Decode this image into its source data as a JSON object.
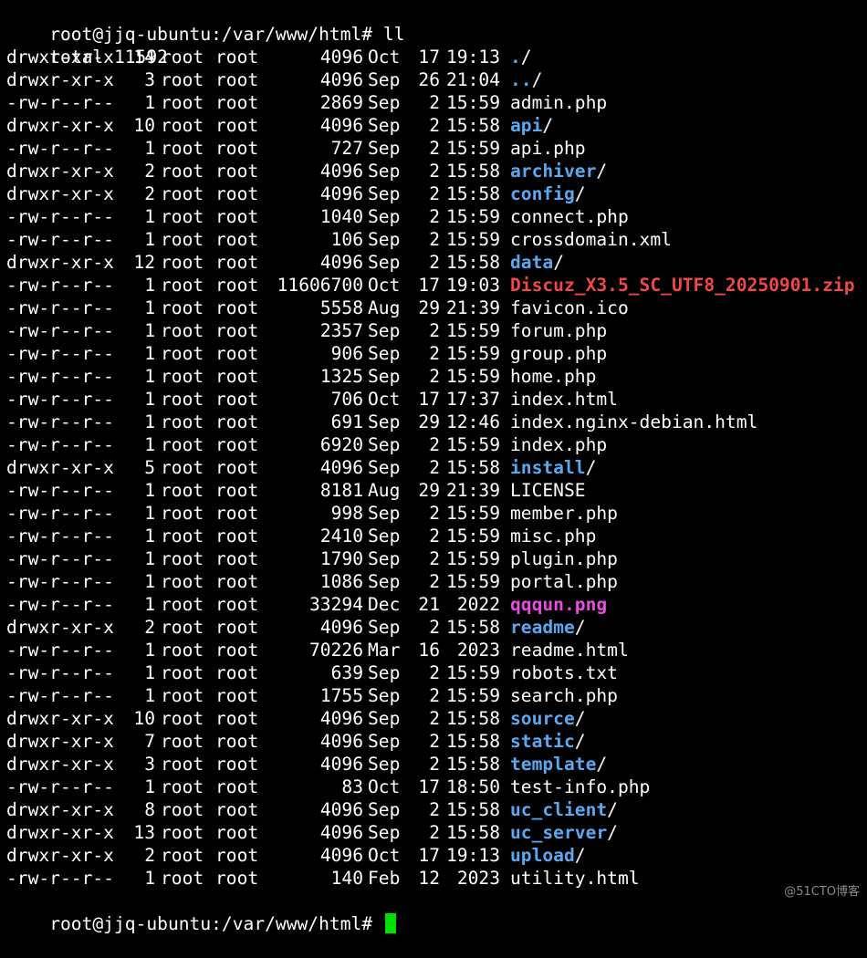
{
  "prompt_cmd": "root@jjq-ubuntu:/var/www/html# ll",
  "total": "total 11592",
  "entries": [
    {
      "perm": "drwxr-xr-x",
      "links": "14",
      "owner": "root",
      "group": "root",
      "size": "4096",
      "month": "Oct",
      "day": "17",
      "time": "19:13",
      "name": "./",
      "kind": "dir"
    },
    {
      "perm": "drwxr-xr-x",
      "links": "3",
      "owner": "root",
      "group": "root",
      "size": "4096",
      "month": "Sep",
      "day": "26",
      "time": "21:04",
      "name": "../",
      "kind": "dir"
    },
    {
      "perm": "-rw-r--r--",
      "links": "1",
      "owner": "root",
      "group": "root",
      "size": "2869",
      "month": "Sep",
      "day": "2",
      "time": "15:59",
      "name": "admin.php",
      "kind": "file"
    },
    {
      "perm": "drwxr-xr-x",
      "links": "10",
      "owner": "root",
      "group": "root",
      "size": "4096",
      "month": "Sep",
      "day": "2",
      "time": "15:58",
      "name": "api",
      "kind": "dir"
    },
    {
      "perm": "-rw-r--r--",
      "links": "1",
      "owner": "root",
      "group": "root",
      "size": "727",
      "month": "Sep",
      "day": "2",
      "time": "15:59",
      "name": "api.php",
      "kind": "file"
    },
    {
      "perm": "drwxr-xr-x",
      "links": "2",
      "owner": "root",
      "group": "root",
      "size": "4096",
      "month": "Sep",
      "day": "2",
      "time": "15:58",
      "name": "archiver",
      "kind": "dir"
    },
    {
      "perm": "drwxr-xr-x",
      "links": "2",
      "owner": "root",
      "group": "root",
      "size": "4096",
      "month": "Sep",
      "day": "2",
      "time": "15:58",
      "name": "config",
      "kind": "dir"
    },
    {
      "perm": "-rw-r--r--",
      "links": "1",
      "owner": "root",
      "group": "root",
      "size": "1040",
      "month": "Sep",
      "day": "2",
      "time": "15:59",
      "name": "connect.php",
      "kind": "file"
    },
    {
      "perm": "-rw-r--r--",
      "links": "1",
      "owner": "root",
      "group": "root",
      "size": "106",
      "month": "Sep",
      "day": "2",
      "time": "15:59",
      "name": "crossdomain.xml",
      "kind": "file"
    },
    {
      "perm": "drwxr-xr-x",
      "links": "12",
      "owner": "root",
      "group": "root",
      "size": "4096",
      "month": "Sep",
      "day": "2",
      "time": "15:58",
      "name": "data",
      "kind": "dir"
    },
    {
      "perm": "-rw-r--r--",
      "links": "1",
      "owner": "root",
      "group": "root",
      "size": "11606700",
      "month": "Oct",
      "day": "17",
      "time": "19:03",
      "name": "Discuz_X3.5_SC_UTF8_20250901.zip",
      "kind": "archive"
    },
    {
      "perm": "-rw-r--r--",
      "links": "1",
      "owner": "root",
      "group": "root",
      "size": "5558",
      "month": "Aug",
      "day": "29",
      "time": "21:39",
      "name": "favicon.ico",
      "kind": "file"
    },
    {
      "perm": "-rw-r--r--",
      "links": "1",
      "owner": "root",
      "group": "root",
      "size": "2357",
      "month": "Sep",
      "day": "2",
      "time": "15:59",
      "name": "forum.php",
      "kind": "file"
    },
    {
      "perm": "-rw-r--r--",
      "links": "1",
      "owner": "root",
      "group": "root",
      "size": "906",
      "month": "Sep",
      "day": "2",
      "time": "15:59",
      "name": "group.php",
      "kind": "file"
    },
    {
      "perm": "-rw-r--r--",
      "links": "1",
      "owner": "root",
      "group": "root",
      "size": "1325",
      "month": "Sep",
      "day": "2",
      "time": "15:59",
      "name": "home.php",
      "kind": "file"
    },
    {
      "perm": "-rw-r--r--",
      "links": "1",
      "owner": "root",
      "group": "root",
      "size": "706",
      "month": "Oct",
      "day": "17",
      "time": "17:37",
      "name": "index.html",
      "kind": "file"
    },
    {
      "perm": "-rw-r--r--",
      "links": "1",
      "owner": "root",
      "group": "root",
      "size": "691",
      "month": "Sep",
      "day": "29",
      "time": "12:46",
      "name": "index.nginx-debian.html",
      "kind": "file"
    },
    {
      "perm": "-rw-r--r--",
      "links": "1",
      "owner": "root",
      "group": "root",
      "size": "6920",
      "month": "Sep",
      "day": "2",
      "time": "15:59",
      "name": "index.php",
      "kind": "file"
    },
    {
      "perm": "drwxr-xr-x",
      "links": "5",
      "owner": "root",
      "group": "root",
      "size": "4096",
      "month": "Sep",
      "day": "2",
      "time": "15:58",
      "name": "install",
      "kind": "dir"
    },
    {
      "perm": "-rw-r--r--",
      "links": "1",
      "owner": "root",
      "group": "root",
      "size": "8181",
      "month": "Aug",
      "day": "29",
      "time": "21:39",
      "name": "LICENSE",
      "kind": "file"
    },
    {
      "perm": "-rw-r--r--",
      "links": "1",
      "owner": "root",
      "group": "root",
      "size": "998",
      "month": "Sep",
      "day": "2",
      "time": "15:59",
      "name": "member.php",
      "kind": "file"
    },
    {
      "perm": "-rw-r--r--",
      "links": "1",
      "owner": "root",
      "group": "root",
      "size": "2410",
      "month": "Sep",
      "day": "2",
      "time": "15:59",
      "name": "misc.php",
      "kind": "file"
    },
    {
      "perm": "-rw-r--r--",
      "links": "1",
      "owner": "root",
      "group": "root",
      "size": "1790",
      "month": "Sep",
      "day": "2",
      "time": "15:59",
      "name": "plugin.php",
      "kind": "file"
    },
    {
      "perm": "-rw-r--r--",
      "links": "1",
      "owner": "root",
      "group": "root",
      "size": "1086",
      "month": "Sep",
      "day": "2",
      "time": "15:59",
      "name": "portal.php",
      "kind": "file"
    },
    {
      "perm": "-rw-r--r--",
      "links": "1",
      "owner": "root",
      "group": "root",
      "size": "33294",
      "month": "Dec",
      "day": "21",
      "time": "2022",
      "name": "qqqun.png",
      "kind": "image"
    },
    {
      "perm": "drwxr-xr-x",
      "links": "2",
      "owner": "root",
      "group": "root",
      "size": "4096",
      "month": "Sep",
      "day": "2",
      "time": "15:58",
      "name": "readme",
      "kind": "dir"
    },
    {
      "perm": "-rw-r--r--",
      "links": "1",
      "owner": "root",
      "group": "root",
      "size": "70226",
      "month": "Mar",
      "day": "16",
      "time": "2023",
      "name": "readme.html",
      "kind": "file"
    },
    {
      "perm": "-rw-r--r--",
      "links": "1",
      "owner": "root",
      "group": "root",
      "size": "639",
      "month": "Sep",
      "day": "2",
      "time": "15:59",
      "name": "robots.txt",
      "kind": "file"
    },
    {
      "perm": "-rw-r--r--",
      "links": "1",
      "owner": "root",
      "group": "root",
      "size": "1755",
      "month": "Sep",
      "day": "2",
      "time": "15:59",
      "name": "search.php",
      "kind": "file"
    },
    {
      "perm": "drwxr-xr-x",
      "links": "10",
      "owner": "root",
      "group": "root",
      "size": "4096",
      "month": "Sep",
      "day": "2",
      "time": "15:58",
      "name": "source",
      "kind": "dir"
    },
    {
      "perm": "drwxr-xr-x",
      "links": "7",
      "owner": "root",
      "group": "root",
      "size": "4096",
      "month": "Sep",
      "day": "2",
      "time": "15:58",
      "name": "static",
      "kind": "dir"
    },
    {
      "perm": "drwxr-xr-x",
      "links": "3",
      "owner": "root",
      "group": "root",
      "size": "4096",
      "month": "Sep",
      "day": "2",
      "time": "15:58",
      "name": "template",
      "kind": "dir"
    },
    {
      "perm": "-rw-r--r--",
      "links": "1",
      "owner": "root",
      "group": "root",
      "size": "83",
      "month": "Oct",
      "day": "17",
      "time": "18:50",
      "name": "test-info.php",
      "kind": "file"
    },
    {
      "perm": "drwxr-xr-x",
      "links": "8",
      "owner": "root",
      "group": "root",
      "size": "4096",
      "month": "Sep",
      "day": "2",
      "time": "15:58",
      "name": "uc_client",
      "kind": "dir"
    },
    {
      "perm": "drwxr-xr-x",
      "links": "13",
      "owner": "root",
      "group": "root",
      "size": "4096",
      "month": "Sep",
      "day": "2",
      "time": "15:58",
      "name": "uc_server",
      "kind": "dir"
    },
    {
      "perm": "drwxr-xr-x",
      "links": "2",
      "owner": "root",
      "group": "root",
      "size": "4096",
      "month": "Oct",
      "day": "17",
      "time": "19:13",
      "name": "upload",
      "kind": "dir"
    },
    {
      "perm": "-rw-r--r--",
      "links": "1",
      "owner": "root",
      "group": "root",
      "size": "140",
      "month": "Feb",
      "day": "12",
      "time": "2023",
      "name": "utility.html",
      "kind": "file"
    }
  ],
  "prompt_final": "root@jjq-ubuntu:/var/www/html# ",
  "watermark": "@51CTO博客",
  "colors": {
    "background": "#000000",
    "text": "#ffffff",
    "directory": "#5aa9f0",
    "archive": "#f04848",
    "image": "#e84ce0",
    "cursor": "#00e000"
  }
}
